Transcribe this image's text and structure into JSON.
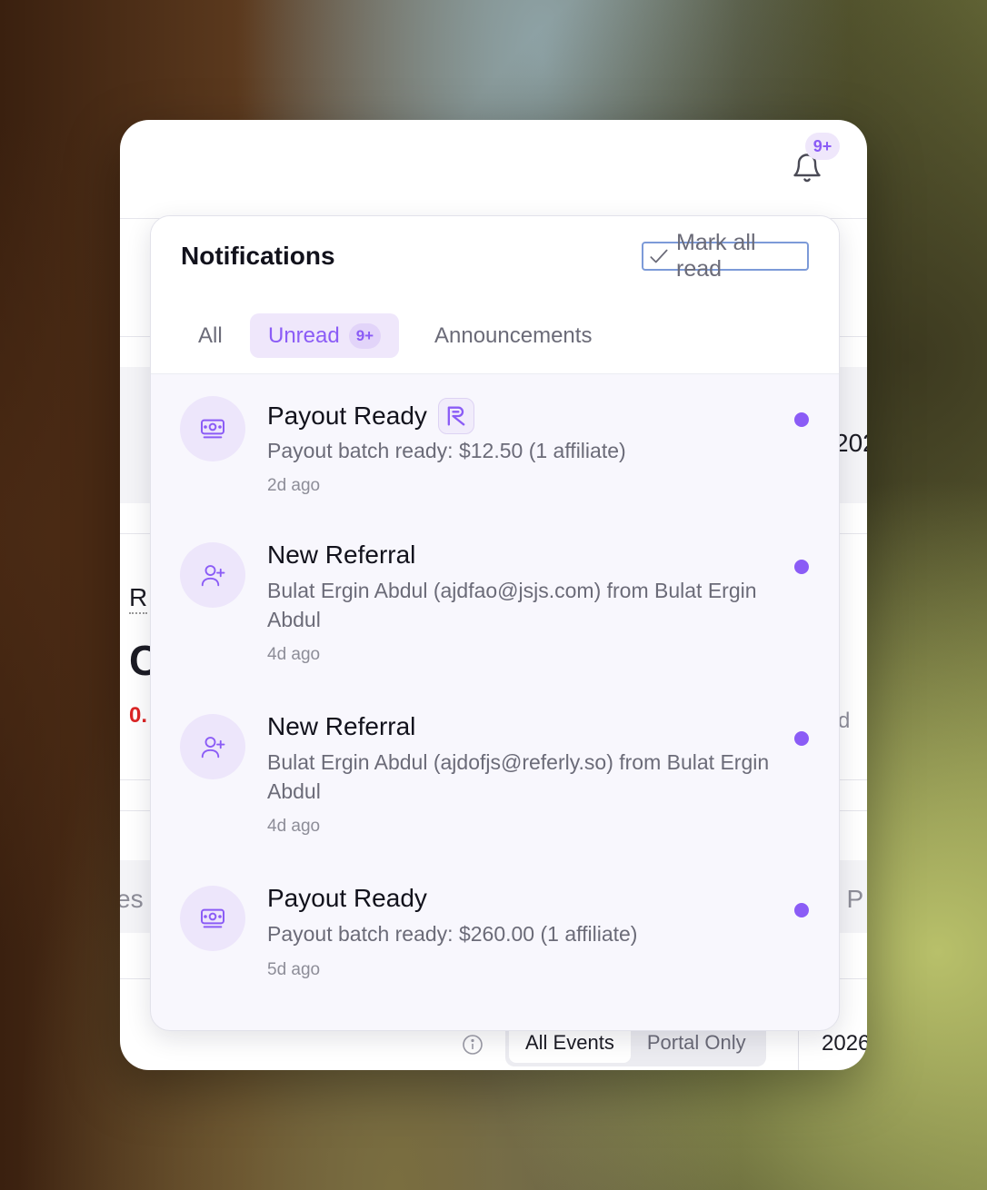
{
  "header": {
    "bell_badge": "9+"
  },
  "background": {
    "frag_r": "R",
    "frag_c": "C",
    "frag_o": "0.",
    "frag_es": "es",
    "frag_202": "202",
    "frag_d": "d",
    "frag_tp": "t P",
    "events_all": "All Events",
    "events_portal": "Portal Only",
    "year": "2026"
  },
  "panel": {
    "title": "Notifications",
    "mark_all_read": "Mark all read",
    "tabs": {
      "all": "All",
      "unread": "Unread",
      "unread_count": "9+",
      "announcements": "Announcements"
    },
    "notifications": [
      {
        "title": "Payout Ready",
        "body": "Payout batch ready: $12.50 (1 affiliate)",
        "time": "2d ago",
        "icon": "money-icon"
      },
      {
        "title": "New Referral",
        "body": "Bulat Ergin Abdul (ajdfao@jsjs.com) from Bulat Ergin Abdul",
        "time": "4d ago",
        "icon": "user-plus-icon"
      },
      {
        "title": "New Referral",
        "body": "Bulat Ergin Abdul (ajdofjs@referly.so) from Bulat Ergin Abdul",
        "time": "4d ago",
        "icon": "user-plus-icon"
      },
      {
        "title": "Payout Ready",
        "body": "Payout batch ready: $260.00 (1 affiliate)",
        "time": "5d ago",
        "icon": "money-icon"
      }
    ]
  },
  "colors": {
    "accent": "#8b5cf6",
    "accent_soft": "#efe7fb",
    "negative": "#dc2626"
  }
}
